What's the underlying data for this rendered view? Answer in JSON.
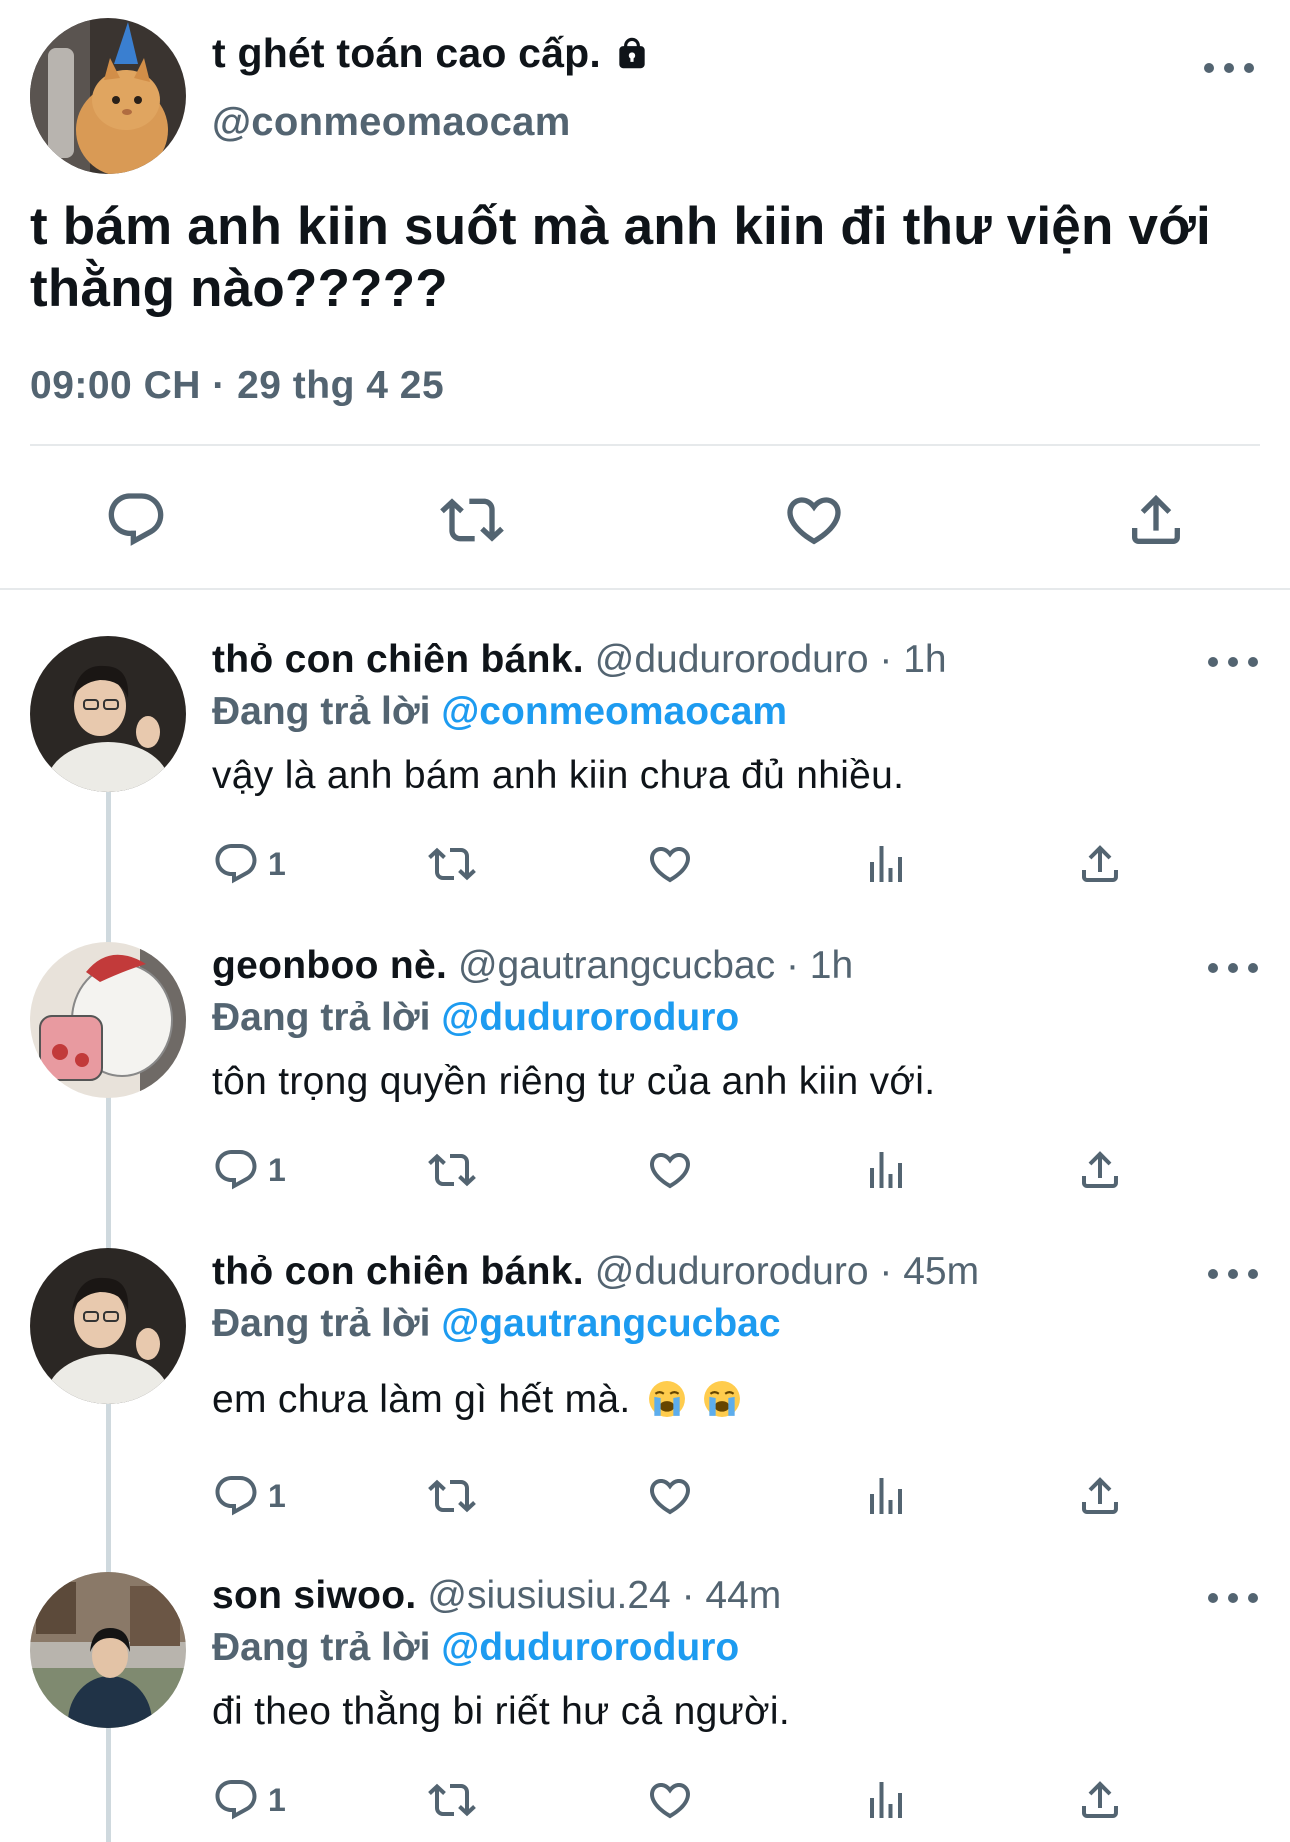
{
  "main_tweet": {
    "display_name": "t ghét toán cao cấp.",
    "handle": "@conmeomaocam",
    "protected_icon": "lock-icon",
    "text": "t bám anh kiin suốt mà anh kiin đi thư viện với thằng nào?????",
    "timestamp": "09:00 CH · 29 thg 4 25",
    "actions": [
      "reply-icon",
      "retweet-icon",
      "like-icon",
      "share-icon"
    ]
  },
  "replies": [
    {
      "display_name": "thỏ con chiên bánk.",
      "handle": "@duduroroduro",
      "separator": "·",
      "time": "1h",
      "reply_prefix": "Đang trả lời",
      "reply_to": "@conmeomaocam",
      "text": "vậy là anh bám anh kiin chưa đủ nhiều.",
      "reply_count": "1"
    },
    {
      "display_name": "geonboo nè.",
      "handle": "@gautrangcucbac",
      "separator": "·",
      "time": "1h",
      "reply_prefix": "Đang trả lời",
      "reply_to": "@duduroroduro",
      "text": "tôn trọng quyền riêng tư của anh kiin với.",
      "reply_count": "1"
    },
    {
      "display_name": "thỏ con chiên bánk.",
      "handle": "@duduroroduro",
      "separator": "·",
      "time": "45m",
      "reply_prefix": "Đang trả lời",
      "reply_to": "@gautrangcucbac",
      "text": "em chưa làm gì hết mà.",
      "emoji": [
        "loudly-crying-face",
        "loudly-crying-face"
      ],
      "reply_count": "1"
    },
    {
      "display_name": "son siwoo.",
      "handle": "@siusiusiu.24",
      "separator": "·",
      "time": "44m",
      "reply_prefix": "Đang trả lời",
      "reply_to": "@duduroroduro",
      "text": "đi theo thằng bi riết hư cả người.",
      "reply_count": "1"
    }
  ],
  "colors": {
    "text": "#0f1419",
    "secondary": "#536471",
    "link": "#1d9bf0",
    "divider": "#e6e9eb",
    "thread_line": "#cfd9de"
  }
}
